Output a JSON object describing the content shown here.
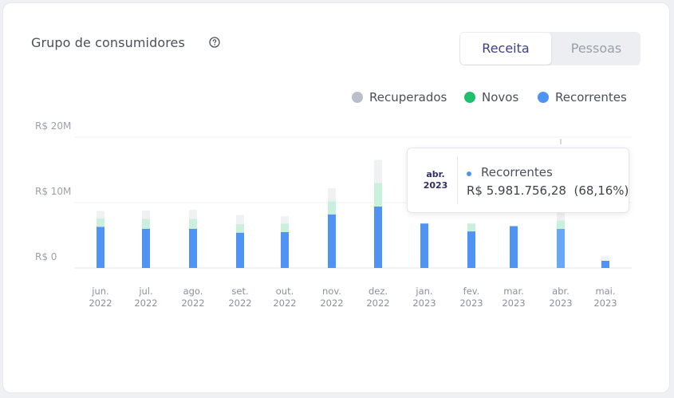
{
  "header": {
    "title": "Grupo de consumidores",
    "help_icon": "question-circle-icon"
  },
  "toggle": {
    "active_label": "Receita",
    "inactive_label": "Pessoas"
  },
  "colors": {
    "recuperados": "#b9bec9",
    "novos": "#1fbf6b",
    "recorrentes": "#4f93f5",
    "bar_recuperados": "#f0f1f3",
    "bar_novos": "#c9f0dc",
    "bar_recorrentes": "#4f93f5",
    "active_text": "#3d3f86"
  },
  "tooltip": {
    "month": "abr.",
    "year": "2023",
    "series": "Recorrentes",
    "value": "R$ 5.981.756,28",
    "percent": "(68,16%)"
  },
  "chart_data": {
    "type": "bar",
    "stacked": true,
    "categories": [
      [
        "jun.",
        "2022"
      ],
      [
        "jul.",
        "2022"
      ],
      [
        "ago.",
        "2022"
      ],
      [
        "set.",
        "2022"
      ],
      [
        "out.",
        "2022"
      ],
      [
        "nov.",
        "2022"
      ],
      [
        "dez.",
        "2022"
      ],
      [
        "jan.",
        "2023"
      ],
      [
        "fev.",
        "2023"
      ],
      [
        "mar.",
        "2023"
      ],
      [
        "abr.",
        "2023"
      ],
      [
        "mai.",
        "2023"
      ]
    ],
    "series": [
      {
        "name": "Recorrentes",
        "values": [
          6.3,
          6.0,
          6.0,
          5.4,
          5.5,
          8.2,
          9.4,
          6.8,
          5.6,
          6.4,
          5.98,
          1.1
        ]
      },
      {
        "name": "Novos",
        "values": [
          1.3,
          1.5,
          1.5,
          1.3,
          1.3,
          2.0,
          3.6,
          0.0,
          1.2,
          0.0,
          1.3,
          0.0
        ]
      },
      {
        "name": "Recuperados",
        "values": [
          1.1,
          1.3,
          1.4,
          1.4,
          1.1,
          2.0,
          3.5,
          0.0,
          0.0,
          0.0,
          1.5,
          0.7
        ]
      }
    ],
    "legend": [
      "Recuperados",
      "Novos",
      "Recorrentes"
    ],
    "y_ticks": [
      "R$ 0",
      "R$ 10M",
      "R$ 20M"
    ],
    "ylim": [
      0,
      20
    ],
    "highlighted": "abr. 2023",
    "legend_position": "top-right",
    "grid": true
  }
}
